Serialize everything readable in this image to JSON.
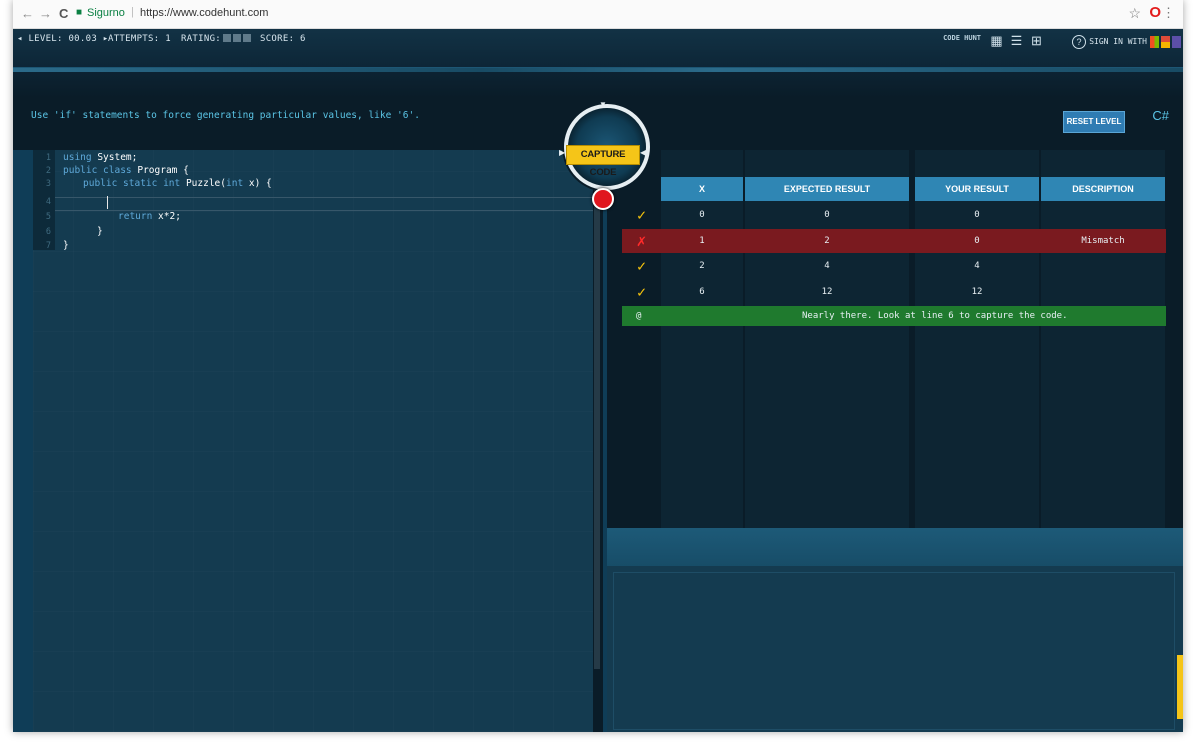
{
  "browser": {
    "back": "←",
    "forward": "→",
    "reload": "C",
    "secure_label": "Sigurno",
    "url": "https://www.codehunt.com",
    "star": "☆",
    "opera": "O",
    "menu": "⋮"
  },
  "stats": {
    "level_label": "LEVEL:",
    "level_value": "00.03",
    "attempts_label": "ATTEMPTS:",
    "attempts_value": "1",
    "rating_label": "RATING:",
    "score_label": "SCORE:",
    "score_value": "6"
  },
  "header": {
    "logo": "CODE HUNT",
    "signin": "SIGN IN WITH"
  },
  "hint": "Use 'if' statements to force generating particular values, like '6'.",
  "capture_label": "CAPTURE CODE",
  "toolbar": {
    "reset_label": "RESET LEVEL",
    "language": "C#"
  },
  "code": {
    "line_numbers": [
      "1",
      "2",
      "3",
      "4",
      "5",
      "6",
      "7"
    ],
    "lines": {
      "l1_kw": "using",
      "l1_rest": " System;",
      "l2_kw": "public class",
      "l2_rest": " Program {",
      "l3_kw": "public static int",
      "l3_rest": " Puzzle(",
      "l3_kw2": "int",
      "l3_rest2": " x) {",
      "l5_kw": "return",
      "l5_rest": " x*2;",
      "l6": "}",
      "l7": "}"
    }
  },
  "results": {
    "headers": [
      "X",
      "EXPECTED RESULT",
      "YOUR RESULT",
      "DESCRIPTION"
    ],
    "rows": [
      {
        "status": "✓",
        "x": "0",
        "expected": "0",
        "yours": "0",
        "description": ""
      },
      {
        "status": "✗",
        "x": "1",
        "expected": "2",
        "yours": "0",
        "description": "Mismatch"
      },
      {
        "status": "✓",
        "x": "2",
        "expected": "4",
        "yours": "4",
        "description": ""
      },
      {
        "status": "✓",
        "x": "6",
        "expected": "12",
        "yours": "12",
        "description": ""
      }
    ],
    "message_icon": "@",
    "message": "Nearly there. Look at line 6 to capture the code."
  },
  "colors": {
    "row_error": "#7a1a1f",
    "row_ok": "#0d2533",
    "message": "#1f7a2e",
    "accent": "#f5c518"
  }
}
